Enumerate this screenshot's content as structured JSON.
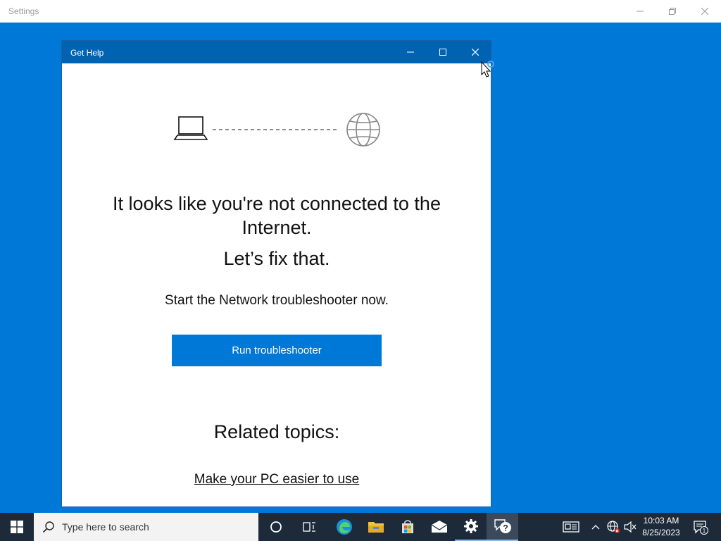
{
  "settings_window": {
    "title": "Settings"
  },
  "get_help_window": {
    "title": "Get Help",
    "headline": "It looks like you're not connected to the Internet.",
    "subheadline": "Let’s fix that.",
    "description": "Start the Network troubleshooter now.",
    "run_button_label": "Run troubleshooter",
    "related_title": "Related topics:",
    "related_link": "Make your PC easier to use"
  },
  "taskbar": {
    "search_placeholder": "Type here to search",
    "time": "10:03 AM",
    "date": "8/25/2023",
    "notification_count": "1",
    "pinned_icons": [
      "cortana-icon",
      "task-view-icon",
      "edge-icon",
      "file-explorer-icon",
      "store-icon",
      "mail-icon",
      "settings-icon",
      "get-help-icon"
    ],
    "tray_icons": [
      "news-icon",
      "chevron-up-icon",
      "network-icon",
      "volume-muted-icon"
    ]
  },
  "colors": {
    "desktop": "#0078d7",
    "accent": "#0078d7",
    "titlebar": "#0063b1",
    "taskbar": "#1c2a3a"
  }
}
